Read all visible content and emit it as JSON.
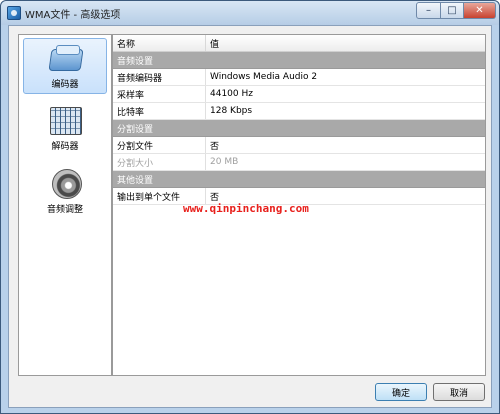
{
  "window": {
    "title": "WMA文件 - 高级选项",
    "controls": {
      "minimize": "–",
      "maximize": "□",
      "close": "✕"
    }
  },
  "nav": {
    "items": [
      {
        "label": "编码器",
        "icon": "encoder-icon",
        "selected": true
      },
      {
        "label": "解码器",
        "icon": "decoder-icon",
        "selected": false
      },
      {
        "label": "音频调整",
        "icon": "speaker-icon",
        "selected": false
      }
    ]
  },
  "grid": {
    "header": {
      "name": "名称",
      "value": "值"
    },
    "sections": [
      {
        "title": "音频设置",
        "rows": [
          {
            "name": "音频编码器",
            "value": "Windows Media Audio 2"
          },
          {
            "name": "采样率",
            "value": "44100 Hz"
          },
          {
            "name": "比特率",
            "value": "128 Kbps"
          }
        ]
      },
      {
        "title": "分割设置",
        "rows": [
          {
            "name": "分割文件",
            "value": "否"
          },
          {
            "name": "分割大小",
            "value": "20 MB",
            "disabled": true
          }
        ]
      },
      {
        "title": "其他设置",
        "rows": [
          {
            "name": "输出到单个文件",
            "value": "否"
          }
        ]
      }
    ]
  },
  "watermark": "www.qinpinchang.com",
  "buttons": {
    "ok": "确定",
    "cancel": "取消"
  },
  "colors": {
    "category_bg": "#a9a9a9",
    "watermark": "#e8201c",
    "selected_nav": "#c9e1fb"
  }
}
